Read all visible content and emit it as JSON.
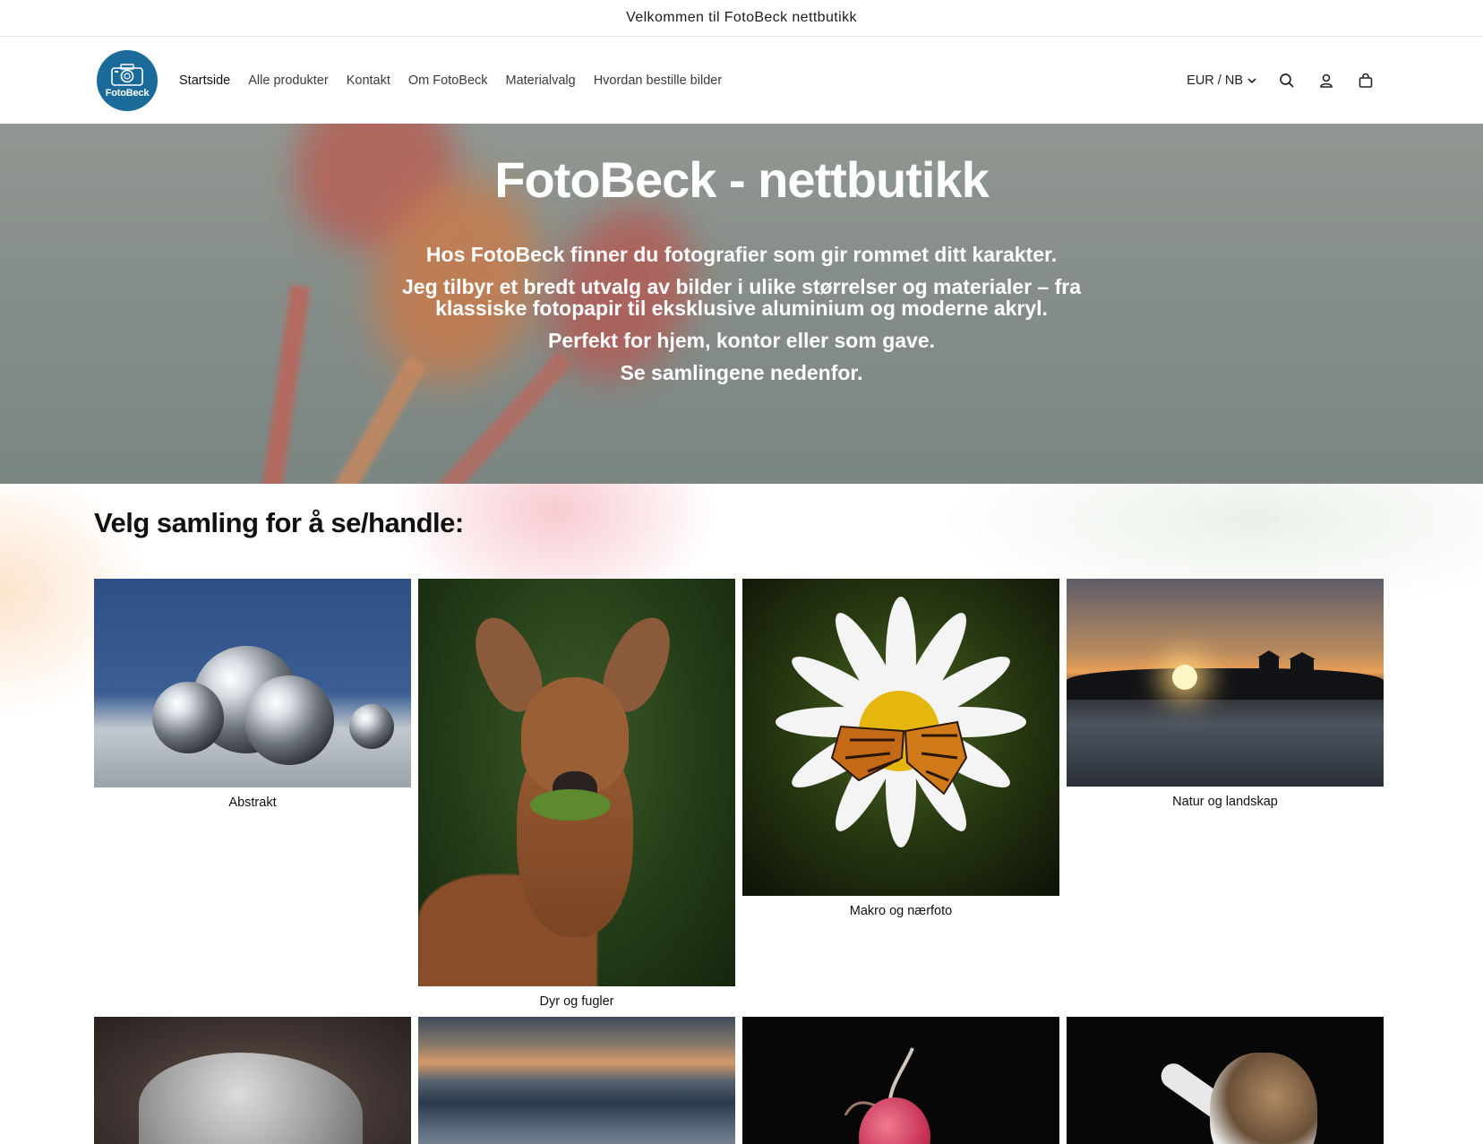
{
  "announcement": "Velkommen til FotoBeck nettbutikk",
  "logo": {
    "text": "FotoBeck",
    "color": "#1b6b9a"
  },
  "nav": [
    {
      "label": "Startside"
    },
    {
      "label": "Alle produkter"
    },
    {
      "label": "Kontakt"
    },
    {
      "label": "Om FotoBeck"
    },
    {
      "label": "Materialvalg"
    },
    {
      "label": "Hvordan bestille bilder"
    }
  ],
  "header": {
    "locale": "EUR / NB",
    "icons": [
      "search-icon",
      "account-icon",
      "cart-icon"
    ]
  },
  "hero": {
    "title": "FotoBeck - nettbutikk",
    "lines": [
      "Hos FotoBeck finner du fotografier som gir rommet ditt karakter.",
      "Jeg tilbyr et bredt utvalg av bilder i ulike størrelser og materialer – fra klassiske fotopapir til eksklusive aluminium og moderne akryl.",
      "Perfekt for hjem, kontor eller som gave.",
      "Se samlingene nedenfor."
    ]
  },
  "collections": {
    "title": "Velg samling for å se/handle:",
    "items": [
      {
        "label": "Abstrakt"
      },
      {
        "label": "Dyr og fugler"
      },
      {
        "label": "Makro og nærfoto"
      },
      {
        "label": "Natur og landskap"
      }
    ]
  }
}
